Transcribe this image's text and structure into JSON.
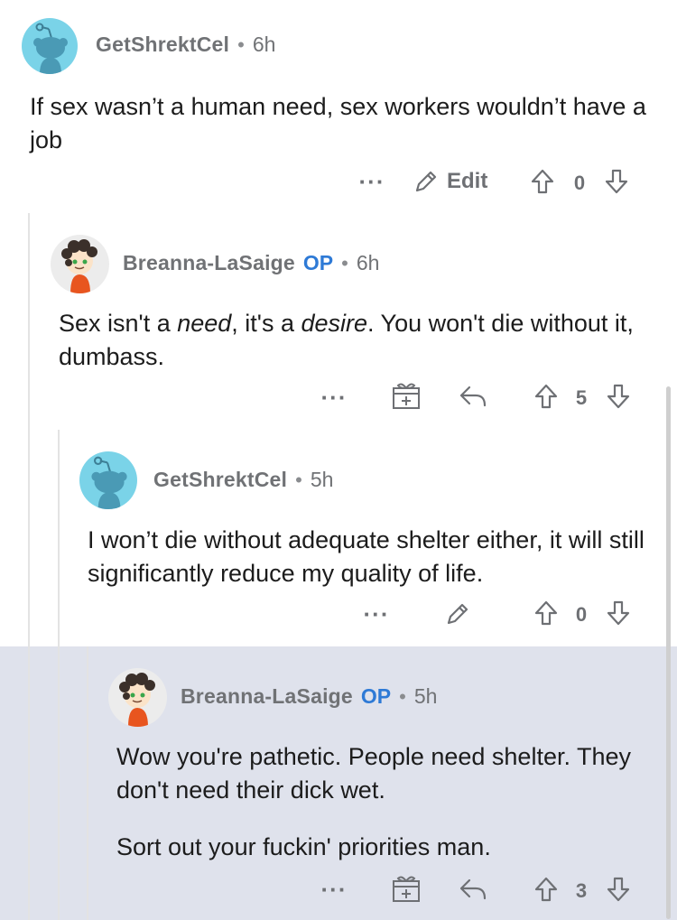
{
  "accent_op_color": "#2e7ad6",
  "highlight_bg": "#dfe2ec",
  "comments": [
    {
      "author": "GetShrektCel",
      "separator": "•",
      "time": "6h",
      "avatar": "snoo-avatar",
      "text": "If sex wasn’t a human need, sex workers wouldn’t have a job",
      "actions": {
        "more": "···",
        "edit_label": "Edit",
        "score": "0"
      }
    },
    {
      "author": "Breanna-LaSaige",
      "op_badge": "OP",
      "separator": "•",
      "time": "6h",
      "avatar": "custom-avatar",
      "text_parts": [
        "Sex isn't a ",
        "need",
        ", it's a ",
        "desire",
        ". You won't die without it, dumbass."
      ],
      "actions": {
        "more": "···",
        "score": "5"
      }
    },
    {
      "author": "GetShrektCel",
      "separator": "•",
      "time": "5h",
      "avatar": "snoo-avatar",
      "text": "I won’t die without adequate shelter either, it will still significantly reduce my quality of life.",
      "actions": {
        "more": "···",
        "score": "0"
      }
    },
    {
      "author": "Breanna-LaSaige",
      "op_badge": "OP",
      "separator": "•",
      "time": "5h",
      "avatar": "custom-avatar",
      "paragraphs": [
        "Wow you're pathetic. People need shelter. They don't need their dick wet.",
        "Sort out your fuckin' priorities man."
      ],
      "actions": {
        "more": "···",
        "score": "3"
      },
      "highlighted": true
    }
  ]
}
